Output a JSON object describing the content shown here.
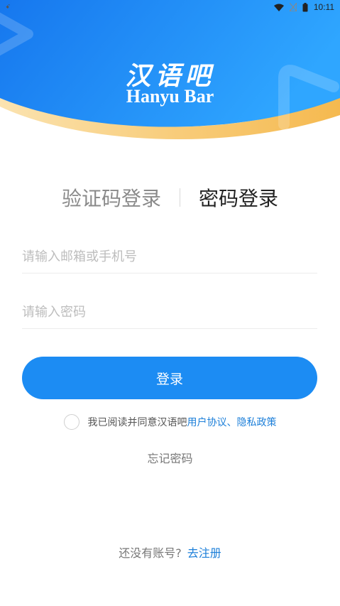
{
  "status_bar": {
    "notification_text": "ꗃ",
    "time": "10:11"
  },
  "header": {
    "logo_cn": "汉语吧",
    "logo_en": "Hanyu Bar"
  },
  "tabs": [
    {
      "label": "验证码登录",
      "active": false
    },
    {
      "label": "密码登录",
      "active": true
    }
  ],
  "form": {
    "email_placeholder": "请输入邮箱或手机号",
    "email_value": "",
    "password_placeholder": "请输入密码",
    "password_value": "",
    "login_label": "登录"
  },
  "agreement": {
    "checked": false,
    "prefix": "我已阅读并同意汉语吧",
    "user_agreement": "用户协议",
    "separator": "、",
    "privacy_policy": "隐私政策"
  },
  "forgot_password": "忘记密码",
  "register": {
    "prompt": "还没有账号?",
    "link": "去注册"
  },
  "colors": {
    "primary": "#1c8cf3",
    "header_gradient_start": "#1677ee",
    "header_gradient_end": "#2fa6ff",
    "wave_accent": "#f7c46b",
    "link": "#1c7fd9"
  },
  "icons": [
    "wifi-icon",
    "signal-icon",
    "battery-icon",
    "checkbox-circle-icon"
  ]
}
